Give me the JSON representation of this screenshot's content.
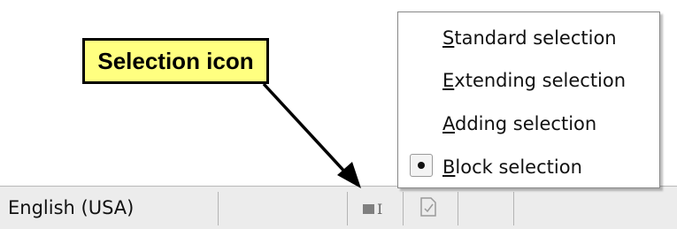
{
  "callout": {
    "text": "Selection icon"
  },
  "statusbar": {
    "language": "English (USA)",
    "selection_icon": "block-selection-icon",
    "doc_icon": "document-modified-icon"
  },
  "menu": {
    "items": [
      {
        "accel": "S",
        "rest": "tandard selection",
        "selected": false
      },
      {
        "accel": "E",
        "rest": "xtending selection",
        "selected": false
      },
      {
        "accel": "A",
        "rest": "dding selection",
        "selected": false
      },
      {
        "accel": "B",
        "rest": "lock selection",
        "selected": true
      }
    ]
  },
  "colors": {
    "callout_fill": "#ffff80",
    "statusbar_bg": "#ececec"
  }
}
